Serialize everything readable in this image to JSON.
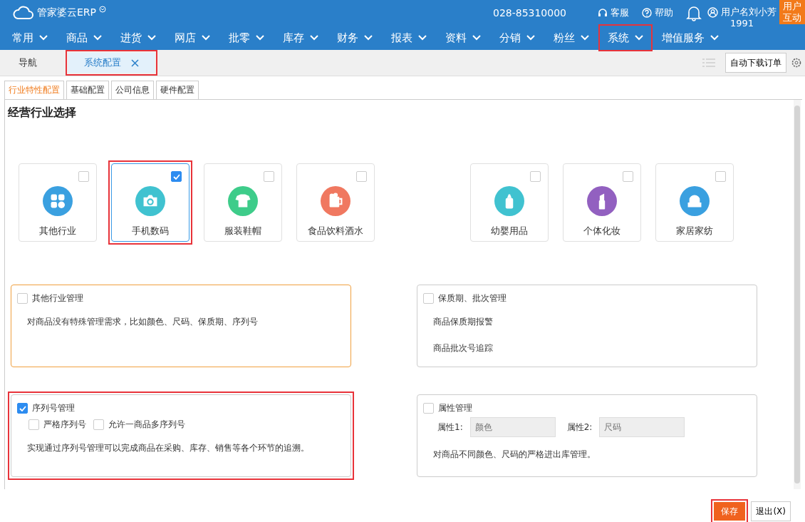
{
  "header": {
    "logo": "管家婆云ERP",
    "phone": "028-85310000",
    "links": [
      {
        "label": "客服",
        "kind": "headset"
      },
      {
        "label": "帮助",
        "kind": "help"
      }
    ],
    "user": {
      "name": "用户名刘小芳",
      "id": "1991"
    },
    "interact": "用户互动"
  },
  "nav": [
    {
      "label": "常用",
      "highlighted": false
    },
    {
      "label": "商品",
      "highlighted": false
    },
    {
      "label": "进货",
      "highlighted": false
    },
    {
      "label": "网店",
      "highlighted": false
    },
    {
      "label": "批零",
      "highlighted": false
    },
    {
      "label": "库存",
      "highlighted": false
    },
    {
      "label": "财务",
      "highlighted": false
    },
    {
      "label": "报表",
      "highlighted": false
    },
    {
      "label": "资料",
      "highlighted": false
    },
    {
      "label": "分销",
      "highlighted": false
    },
    {
      "label": "粉丝",
      "highlighted": false
    },
    {
      "label": "系统",
      "highlighted": true
    },
    {
      "label": "增值服务",
      "highlighted": false
    }
  ],
  "tabs": [
    {
      "label": "导航",
      "selected": false,
      "closable": false,
      "highlighted": false
    },
    {
      "label": "系统配置",
      "selected": true,
      "closable": true,
      "highlighted": true
    }
  ],
  "toolbar": {
    "button": "自动下载订单"
  },
  "subtabs": [
    {
      "label": "行业特性配置",
      "selected": true
    },
    {
      "label": "基础配置",
      "selected": false
    },
    {
      "label": "公司信息",
      "selected": false
    },
    {
      "label": "硬件配置",
      "selected": false
    }
  ],
  "section_title": "经营行业选择",
  "industry_groups": [
    [
      {
        "label": "其他行业",
        "checked": false,
        "color": "#3aa0e0",
        "highlighted": false
      },
      {
        "label": "手机数码",
        "checked": true,
        "color": "#40c2d0",
        "highlighted": true
      },
      {
        "label": "服装鞋帽",
        "checked": false,
        "color": "#3ecc8a",
        "highlighted": false
      },
      {
        "label": "食品饮料酒水",
        "checked": false,
        "color": "#f07860",
        "highlighted": false
      }
    ],
    [
      {
        "label": "幼婴用品",
        "checked": false,
        "color": "#40c2d0",
        "highlighted": false
      },
      {
        "label": "个体化妆",
        "checked": false,
        "color": "#9260c0",
        "highlighted": false
      },
      {
        "label": "家居家纺",
        "checked": false,
        "color": "#3aa0e0",
        "highlighted": false
      }
    ]
  ],
  "panels": [
    {
      "title": "其他行业管理",
      "checked": false,
      "focused": true,
      "highlighted": false,
      "lines": [
        "对商品没有特殊管理需求，比如颜色、尺码、保质期、序列号"
      ]
    },
    {
      "title": "保质期、批次管理",
      "checked": false,
      "focused": false,
      "highlighted": false,
      "lines": [
        "商品保质期报警",
        "商品批次号追踪"
      ]
    },
    {
      "title": "序列号管理",
      "checked": true,
      "focused": false,
      "highlighted": true,
      "options": [
        {
          "label": "严格序列号",
          "checked": false
        },
        {
          "label": "允许一商品多序列号",
          "checked": false
        }
      ],
      "lines": [
        "实现通过序列号管理可以完成商品在采购、库存、销售等各个环节的追溯。"
      ]
    },
    {
      "title": "属性管理",
      "checked": false,
      "focused": false,
      "highlighted": false,
      "fields": [
        {
          "label": "属性1:",
          "placeholder": "颜色"
        },
        {
          "label": "属性2:",
          "placeholder": "尺码"
        }
      ],
      "lines": [
        "对商品不同颜色、尺码的严格进出库管理。"
      ]
    }
  ],
  "footer": {
    "save": {
      "label": "保存",
      "highlighted": true
    },
    "exit": "退出(X)"
  }
}
